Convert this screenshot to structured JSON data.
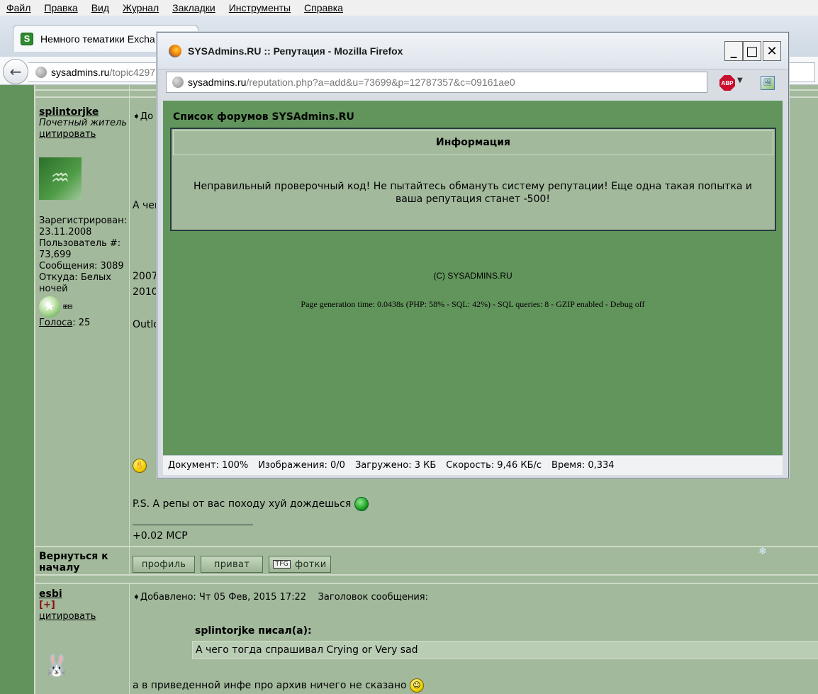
{
  "menubar": [
    "Файл",
    "Правка",
    "Вид",
    "Журнал",
    "Закладки",
    "Инструменты",
    "Справка"
  ],
  "browser": {
    "tab_title": "Немного тематики Excha",
    "url_host": "sysadmins.ru",
    "url_path": "/topic4297"
  },
  "post1": {
    "username": "splintorjke",
    "user_title": "Почетный житель",
    "quote_link": "цитировать",
    "registered_label": "Зарегистрирован:",
    "registered_date": "23.11.2008",
    "user_num_label": "Пользователь #:",
    "user_num": "73,699",
    "messages": "Сообщения: 3089",
    "from_label": "Откуда: Белых",
    "from_value": "ночей",
    "votes_label": "Голоса",
    "votes_value": ": 25",
    "header_fragment": "До",
    "text_a": "А чег",
    "text_2007": "2007",
    "text_2010": "2010",
    "text_outl": "Outlo",
    "ps_text": "P.S. А репы от вас походу хуй дождешься",
    "sig_text": "+0.02 МСР",
    "back_to_top": [
      "Вернуться к",
      "началу"
    ],
    "buttons": [
      "профиль",
      "приват",
      "фотки"
    ]
  },
  "post2": {
    "username": "esbi",
    "plus_label": "[+]",
    "quote_link": "цитировать",
    "header": "Добавлено: Чт 05 Фев, 2015 17:22",
    "subject_label": "Заголовок сообщения:",
    "quote_author": "splintorjke писал(а):",
    "quote_text": "А чего тогда спрашивал Crying or Very sad",
    "reply_text": "а в приведенной инфе про архив ничего не сказано"
  },
  "popup": {
    "window_title": "SYSAdmins.RU :: Репутация - Mozilla Firefox",
    "url_host": "sysadmins.ru",
    "url_path": "/reputation.php?a=add&u=73699&p=12787357&c=09161ae0",
    "minimize": "_",
    "maximize": "□",
    "close": "✕",
    "forums_title": "Список форумов SYSAdmins.RU",
    "info_header": "Информация",
    "info_message": "Неправильный проверочный код! Не пытайтесь обмануть систему репутации! Еще одна такая попытка и ваша репутация станет -500!",
    "copyright": "(C) SYSADMINS.RU",
    "generation": "Page generation time: 0.0438s (PHP: 58% - SQL: 42%) - SQL queries: 8 - GZIP enabled - Debug off",
    "status": {
      "document": "Документ: 100%",
      "images": "Изображения: 0/0",
      "loaded": "Загружено: 3 КБ",
      "speed": "Скорость: 9,46 КБ/с",
      "time": "Время: 0,334"
    }
  },
  "colors": {
    "forum_bg": "#a2b99c",
    "popup_content_bg": "#62955c",
    "sidebar": "#63935d"
  }
}
